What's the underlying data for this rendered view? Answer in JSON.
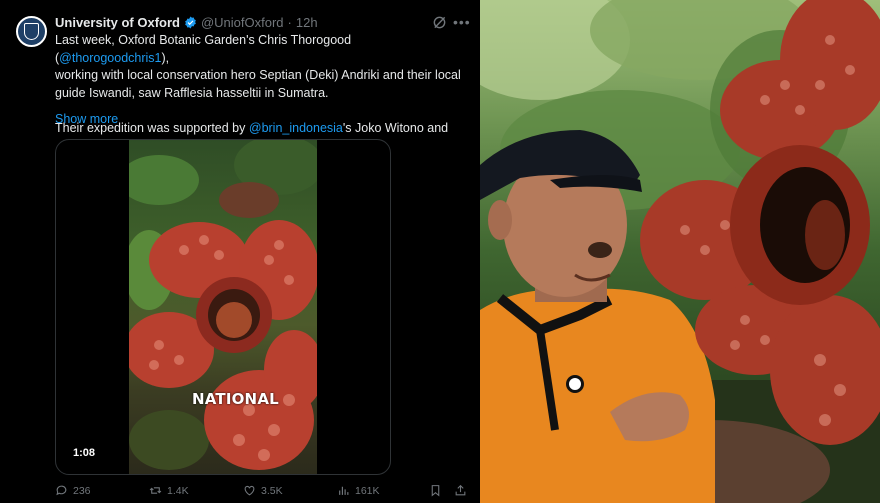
{
  "tweet": {
    "display_name": "University of Oxford",
    "handle": "@UniofOxford",
    "separator": "·",
    "time": "12h",
    "body_line1_prefix": "Last week, Oxford Botanic Garden's Chris Thorogood (",
    "body_mention1": "@thorogoodchris1",
    "body_line1_suffix": "),",
    "body_line2": "working with local conservation hero Septian (Deki) Andriki and their local",
    "body_line3": "guide Iswandi, saw Rafflesia hasseltii in Sumatra.",
    "body_para2_prefix": "Their expedition was supported by ",
    "body_mention2": "@brin_indonesia",
    "body_para2_suffix": "'s Joko Witono and",
    "show_more": "Show more"
  },
  "media": {
    "overlay_text": "NATIONAL",
    "duration": "1:08"
  },
  "actions": {
    "replies": "236",
    "reposts": "1.4K",
    "likes": "3.5K",
    "views": "161K"
  },
  "icons": {
    "verified": "verified-badge-icon",
    "grok": "grok-icon",
    "more": "more-options-icon",
    "reply": "reply-icon",
    "repost": "repost-icon",
    "like": "like-icon",
    "views": "views-icon",
    "bookmark": "bookmark-icon",
    "share": "share-icon"
  },
  "colors": {
    "background": "#000000",
    "link": "#1d9bf0",
    "muted": "#71767b",
    "text": "#e7e9ea",
    "flower": "#b8402f"
  }
}
